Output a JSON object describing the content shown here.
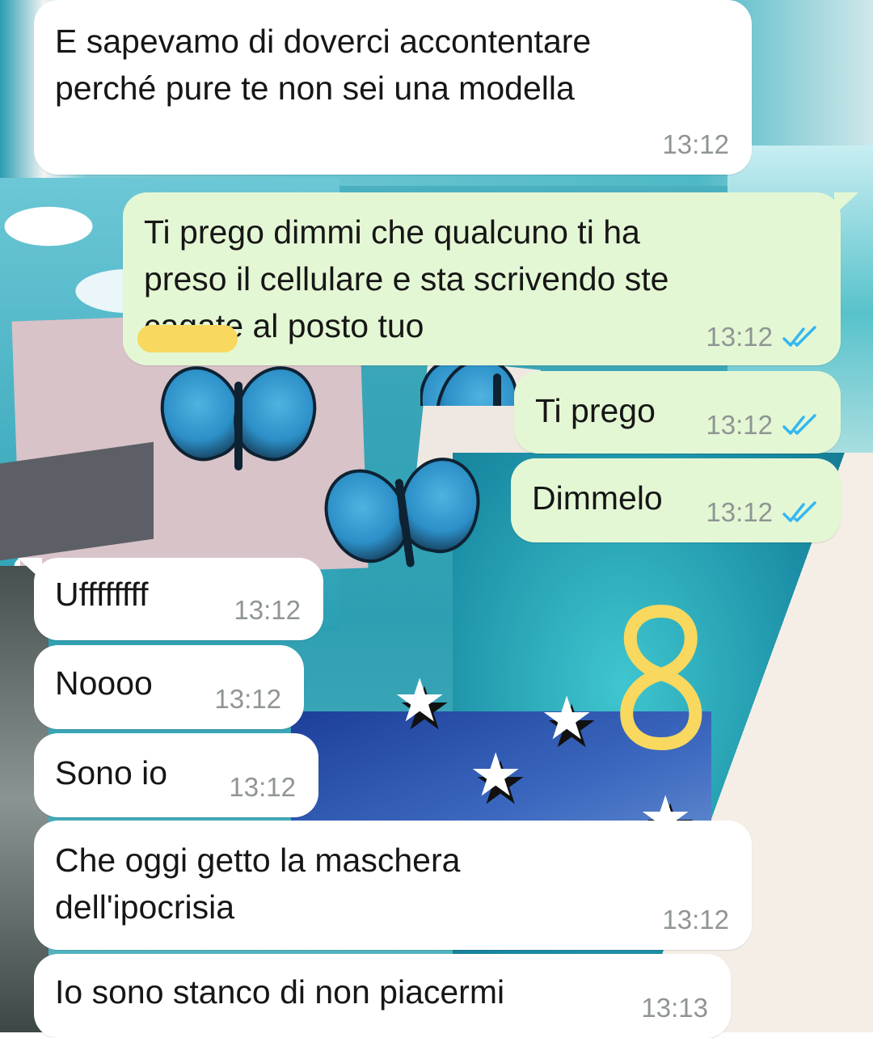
{
  "chat": {
    "messages": [
      {
        "direction": "in",
        "lines": [
          "E sapevamo di doverci accontentare",
          "perché pure te non sei una modella"
        ],
        "time": "13:12"
      },
      {
        "direction": "out",
        "lines": [
          "Ti prego dimmi che qualcuno ti ha",
          "preso il cellulare e sta scrivendo ste",
          "cagate al posto tuo"
        ],
        "time": "13:12",
        "status": "read-double-check"
      },
      {
        "direction": "out",
        "lines": [
          "Ti prego"
        ],
        "time": "13:12",
        "status": "read-double-check"
      },
      {
        "direction": "out",
        "lines": [
          "Dimmelo"
        ],
        "time": "13:12",
        "status": "read-double-check"
      },
      {
        "direction": "in",
        "lines": [
          "Uffffffff"
        ],
        "time": "13:12"
      },
      {
        "direction": "in",
        "lines": [
          "Noooo"
        ],
        "time": "13:12"
      },
      {
        "direction": "in",
        "lines": [
          "Sono io"
        ],
        "time": "13:12"
      },
      {
        "direction": "in",
        "lines": [
          "Che oggi getto la maschera",
          "dell'ipocrisia"
        ],
        "time": "13:12"
      },
      {
        "direction": "in",
        "lines": [
          "Io sono stanco di non piacermi"
        ],
        "time": "13:13"
      }
    ]
  },
  "colors": {
    "incoming_bubble": "#ffffff",
    "outgoing_bubble": "#e4f7d4",
    "timestamp": "#8f9594",
    "read_check": "#34b7f1",
    "redaction_marker": "#f8d85e",
    "scribble_marker": "#f8d85e"
  },
  "icons": {
    "read_receipt": "double-check-icon"
  }
}
